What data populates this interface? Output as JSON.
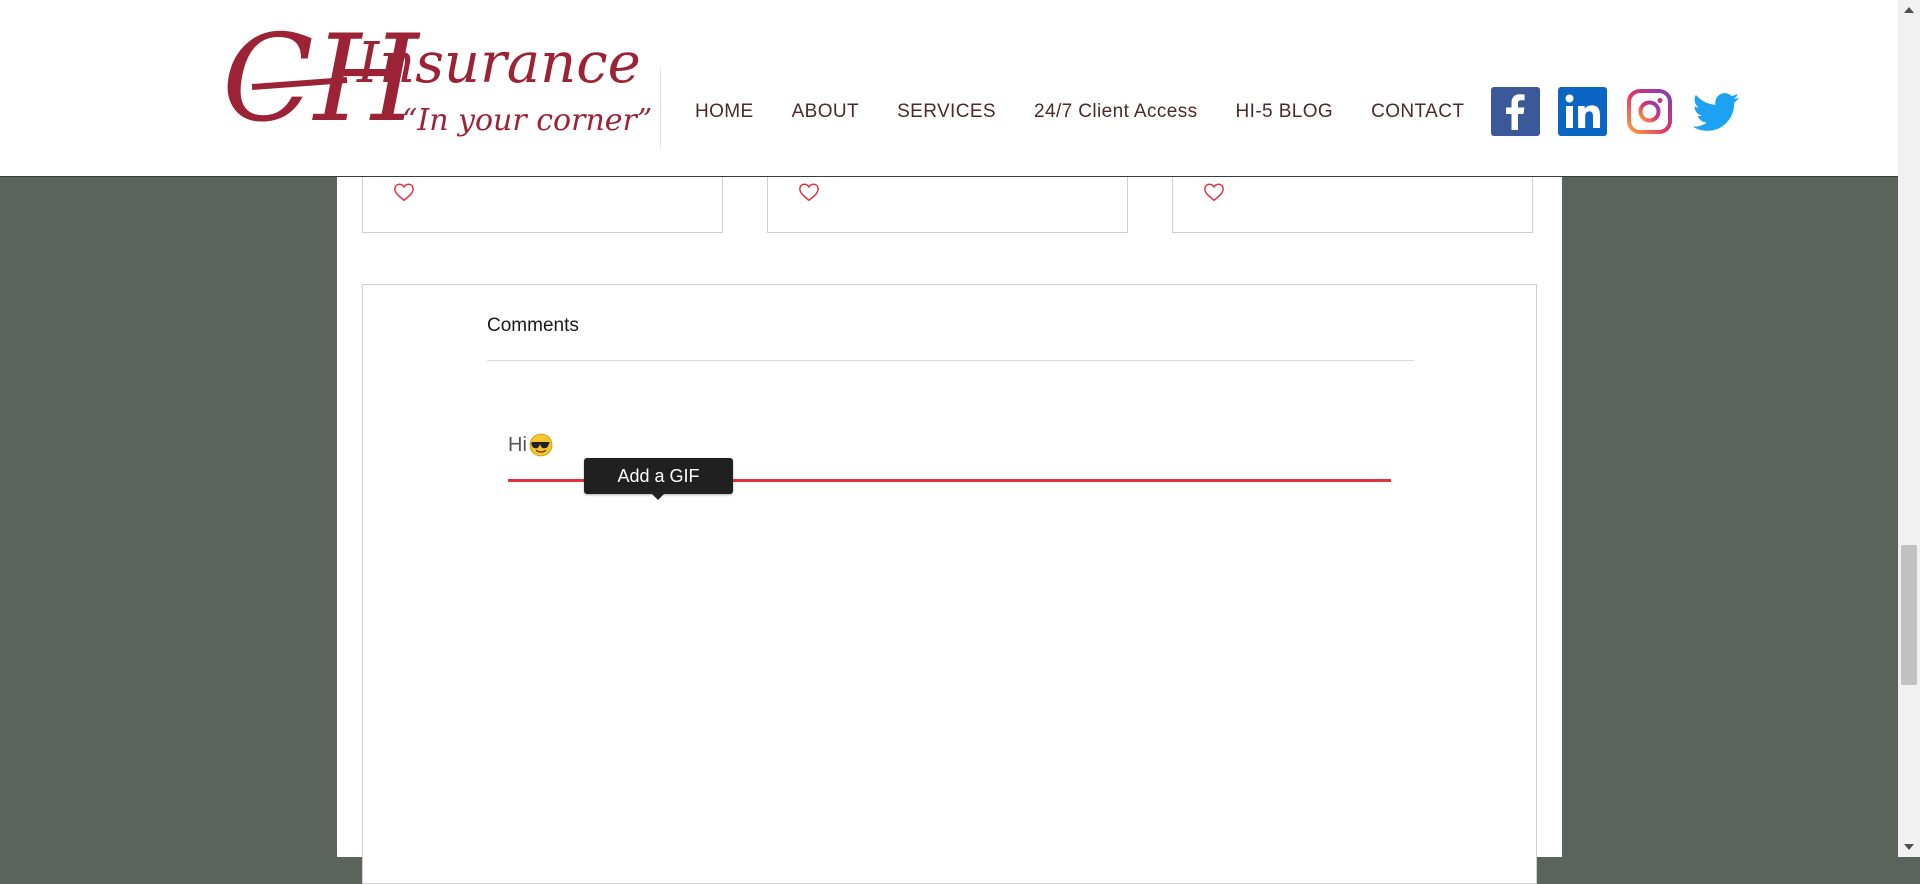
{
  "header": {
    "logo": {
      "monogram": "CH",
      "wordmark": "Insurance",
      "tagline": "“In your corner”",
      "brand_color": "#9b2335"
    },
    "nav": [
      {
        "label": "HOME"
      },
      {
        "label": "ABOUT"
      },
      {
        "label": "SERVICES"
      },
      {
        "label": "24/7 Client Access"
      },
      {
        "label": "HI-5 BLOG"
      },
      {
        "label": "CONTACT"
      }
    ],
    "social": [
      "facebook-icon",
      "linkedin-icon",
      "instagram-icon",
      "twitter-icon"
    ]
  },
  "post_cards": [
    {
      "like_icon": "heart-icon"
    },
    {
      "like_icon": "heart-icon"
    },
    {
      "like_icon": "heart-icon"
    }
  ],
  "comments": {
    "title": "Comments",
    "input_value": "Hi",
    "input_emoji": "smiling-face-with-sunglasses",
    "tooltip": "Add a GIF",
    "accent_color": "#e0323f"
  }
}
